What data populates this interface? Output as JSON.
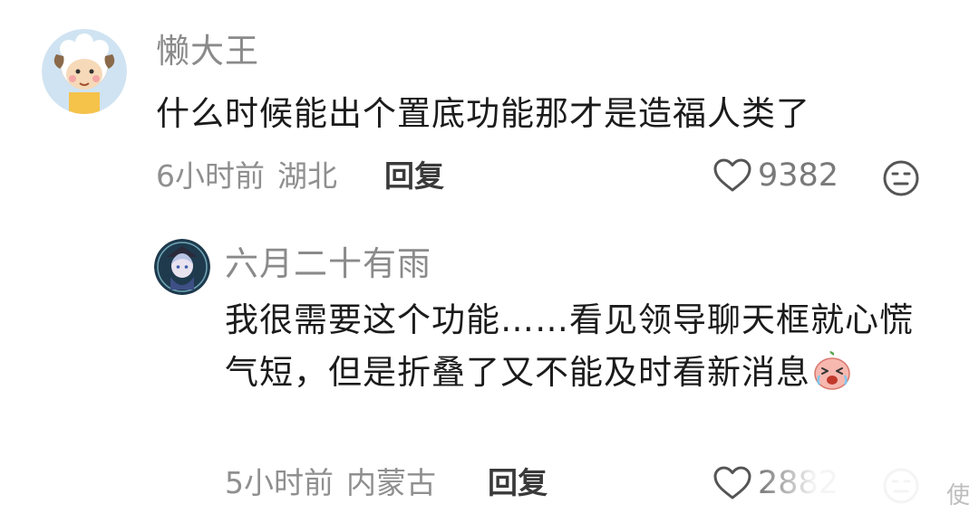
{
  "comments": [
    {
      "username": "懒大王",
      "text": "什么时候能出个置底功能那才是造福人类了",
      "time": "6小时前",
      "location": "湖北",
      "reply_label": "回复",
      "likes": "9382",
      "avatar_icon": "sheep-avatar-icon",
      "action_icon": "dislike-face-icon"
    },
    {
      "username": "六月二十有雨",
      "text": "我很需要这个功能……看见领导聊天框就心慌气短，但是折叠了又不能及时看新消息",
      "time": "5小时前",
      "location": "内蒙古",
      "reply_label": "回复",
      "likes": "2882",
      "avatar_icon": "anime-girl-avatar-icon",
      "inline_emoji": "crying-peach-emoji",
      "action_icon": "dislike-face-icon"
    }
  ],
  "watermark": "使"
}
